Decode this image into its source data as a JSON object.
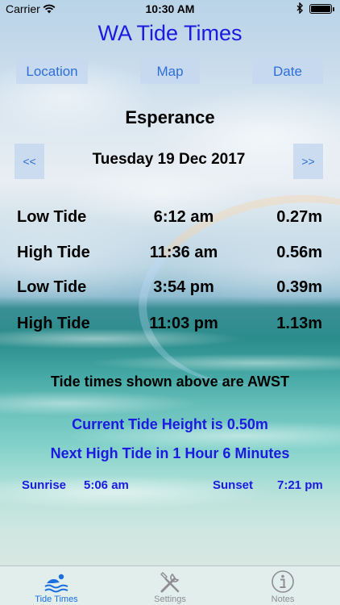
{
  "status_bar": {
    "carrier": "Carrier",
    "time": "10:30 AM",
    "battery_level": 1.0
  },
  "app": {
    "title": "WA Tide Times"
  },
  "nav": {
    "location_label": "Location",
    "map_label": "Map",
    "date_label": "Date"
  },
  "location": {
    "name": "Esperance"
  },
  "date_nav": {
    "prev_label": "<<",
    "next_label": ">>",
    "date": "Tuesday 19 Dec 2017"
  },
  "tides": [
    {
      "type": "Low Tide",
      "time": "6:12 am",
      "height": "0.27m"
    },
    {
      "type": "High Tide",
      "time": "11:36 am",
      "height": "0.56m"
    },
    {
      "type": "Low Tide",
      "time": "3:54 pm",
      "height": "0.39m"
    },
    {
      "type": "High Tide",
      "time": "11:03 pm",
      "height": "1.13m"
    }
  ],
  "info": {
    "timezone_note": "Tide times shown above are AWST",
    "current_height": "Current Tide Height is 0.50m",
    "next_tide": "Next High Tide in 1 Hour 6 Minutes",
    "sunrise_label": "Sunrise",
    "sunrise_time": "5:06 am",
    "sunset_label": "Sunset",
    "sunset_time": "7:21 pm"
  },
  "tab_bar": {
    "tabs": [
      {
        "label": "Tide Times",
        "icon": "swimmer-icon",
        "active": true
      },
      {
        "label": "Settings",
        "icon": "tools-icon",
        "active": false
      },
      {
        "label": "Notes",
        "icon": "info-icon",
        "active": false
      }
    ]
  },
  "colors": {
    "title_blue": "#1a1ae0",
    "button_text": "#2e6fd6",
    "active_tab": "#1a6fe0",
    "inactive_tab": "#8e8e93"
  }
}
